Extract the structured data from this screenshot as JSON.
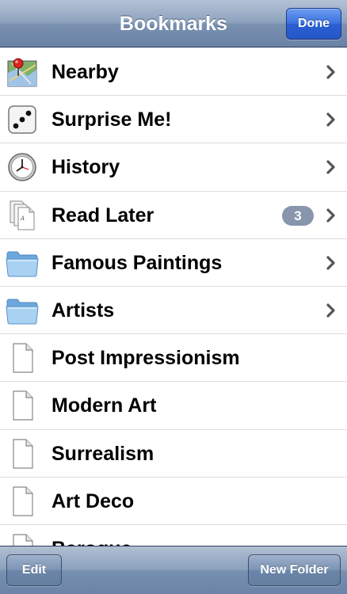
{
  "nav": {
    "title": "Bookmarks",
    "done_label": "Done"
  },
  "list": {
    "items": [
      {
        "label": "Nearby",
        "icon": "map-pin-icon",
        "chevron": true
      },
      {
        "label": "Surprise Me!",
        "icon": "dice-icon",
        "chevron": true
      },
      {
        "label": "History",
        "icon": "clock-icon",
        "chevron": true
      },
      {
        "label": "Read Later",
        "icon": "documents-icon",
        "chevron": true,
        "badge": "3"
      },
      {
        "label": "Famous Paintings",
        "icon": "folder-icon",
        "chevron": true
      },
      {
        "label": "Artists",
        "icon": "folder-icon",
        "chevron": true
      },
      {
        "label": "Post Impressionism",
        "icon": "document-icon",
        "chevron": false
      },
      {
        "label": "Modern Art",
        "icon": "document-icon",
        "chevron": false
      },
      {
        "label": "Surrealism",
        "icon": "document-icon",
        "chevron": false
      },
      {
        "label": "Art Deco",
        "icon": "document-icon",
        "chevron": false
      },
      {
        "label": "Baroque",
        "icon": "document-icon",
        "chevron": false
      }
    ]
  },
  "toolbar": {
    "edit_label": "Edit",
    "new_folder_label": "New Folder"
  },
  "colors": {
    "badge": "#8795ad",
    "done_button": "#2a5fd3",
    "bar": "#7a91b1"
  }
}
